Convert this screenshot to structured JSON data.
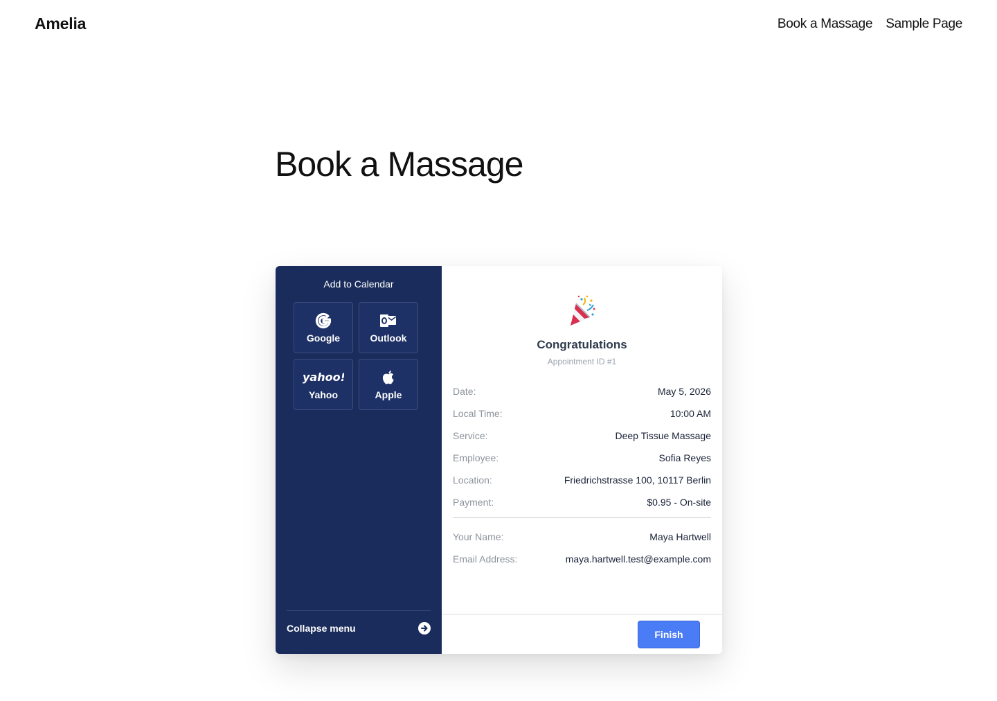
{
  "header": {
    "site_title": "Amelia",
    "nav": [
      {
        "label": "Book a Massage"
      },
      {
        "label": "Sample Page"
      }
    ]
  },
  "page": {
    "heading": "Book a Massage"
  },
  "sidebar": {
    "title": "Add to Calendar",
    "calendars": [
      {
        "label": "Google",
        "icon": "google-icon"
      },
      {
        "label": "Outlook",
        "icon": "outlook-icon"
      },
      {
        "label": "Yahoo",
        "icon": "yahoo-icon"
      },
      {
        "label": "Apple",
        "icon": "apple-icon"
      }
    ],
    "collapse_label": "Collapse menu",
    "collapse_icon": "arrow-right-circle-icon"
  },
  "confirmation": {
    "icon": "party-popper-icon",
    "title": "Congratulations",
    "appointment_id": "Appointment ID #1",
    "details": [
      {
        "key": "Date:",
        "value": "May 5, 2026"
      },
      {
        "key": "Local Time:",
        "value": "10:00 AM"
      },
      {
        "key": "Service:",
        "value": "Deep Tissue Massage"
      },
      {
        "key": "Employee:",
        "value": "Sofia Reyes"
      },
      {
        "key": "Location:",
        "value": "Friedrichstrasse 100, 10117 Berlin"
      },
      {
        "key": "Payment:",
        "value": "$0.95 - On-site"
      }
    ],
    "customer": [
      {
        "key": "Your Name:",
        "value": "Maya Hartwell"
      },
      {
        "key": "Email Address:",
        "value": "maya.hartwell.test@example.com"
      }
    ],
    "finish_label": "Finish"
  },
  "colors": {
    "sidebar_bg": "#1a2c5b",
    "accent": "#4a7cf5"
  }
}
